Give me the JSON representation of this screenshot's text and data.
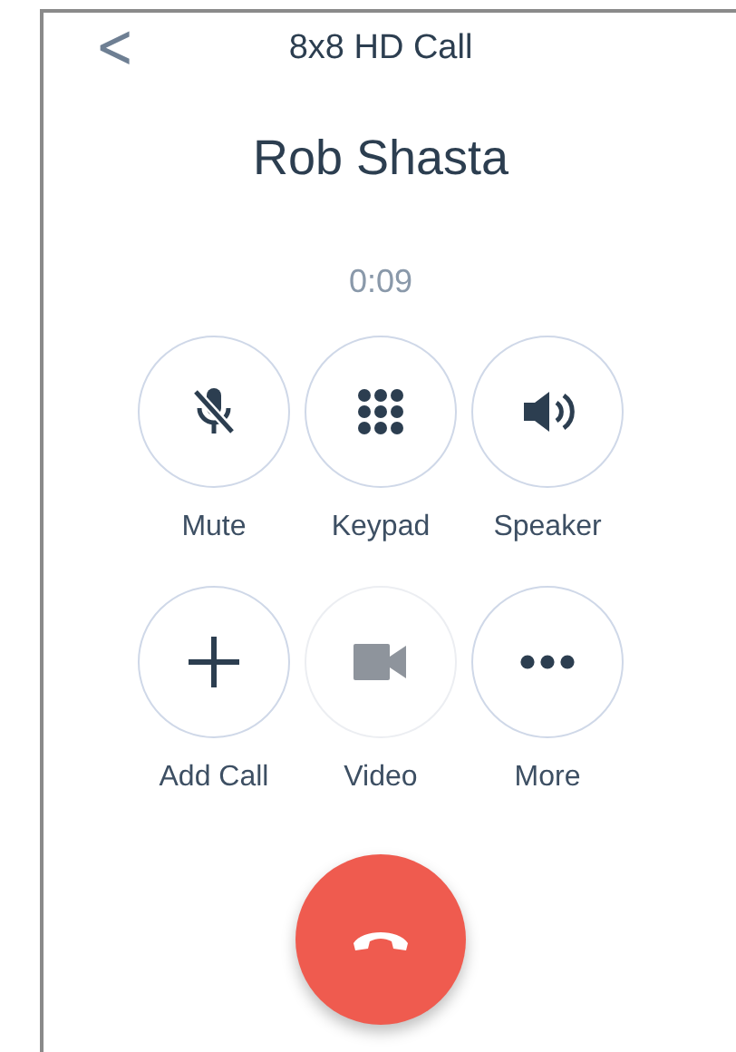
{
  "header": {
    "back": "<",
    "title": "8x8 HD Call"
  },
  "caller": {
    "name": "Rob Shasta",
    "duration": "0:09"
  },
  "controls": [
    {
      "kind": "mute",
      "label": "Mute",
      "disabled": false
    },
    {
      "kind": "keypad",
      "label": "Keypad",
      "disabled": false
    },
    {
      "kind": "speaker",
      "label": "Speaker",
      "disabled": false
    },
    {
      "kind": "add",
      "label": "Add Call",
      "disabled": false
    },
    {
      "kind": "video",
      "label": "Video",
      "disabled": true
    },
    {
      "kind": "more",
      "label": "More",
      "disabled": false
    }
  ],
  "end_call": {
    "kind": "hangup"
  }
}
